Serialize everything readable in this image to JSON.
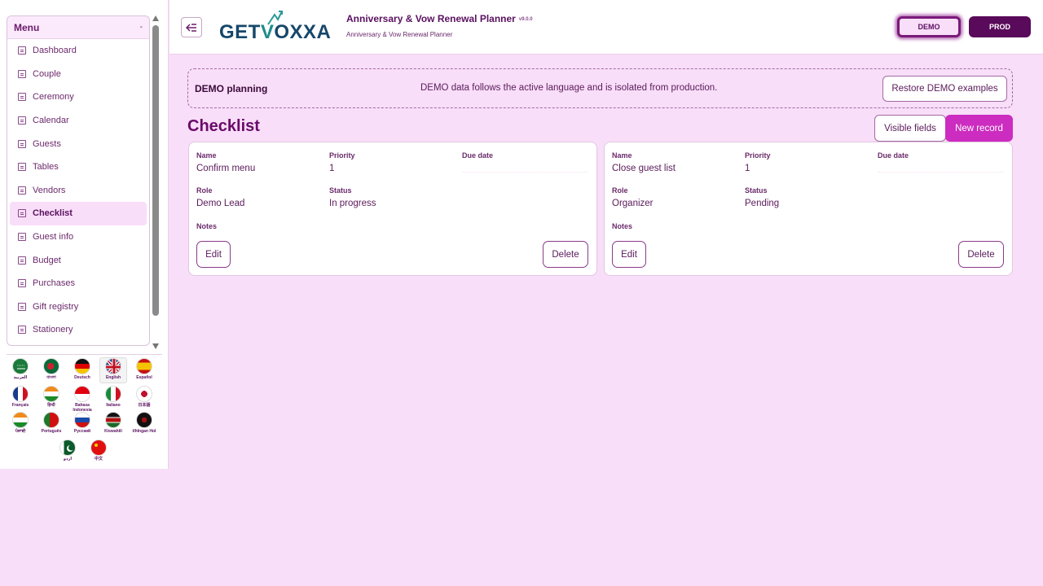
{
  "sidebar": {
    "menu_title": "Menu",
    "toggle": "-",
    "items": [
      {
        "label": "Dashboard"
      },
      {
        "label": "Couple"
      },
      {
        "label": "Ceremony"
      },
      {
        "label": "Calendar"
      },
      {
        "label": "Guests"
      },
      {
        "label": "Tables"
      },
      {
        "label": "Vendors"
      },
      {
        "label": "Checklist",
        "active": true
      },
      {
        "label": "Guest info"
      },
      {
        "label": "Budget"
      },
      {
        "label": "Purchases"
      },
      {
        "label": "Gift registry"
      },
      {
        "label": "Stationery"
      }
    ],
    "languages": [
      {
        "label": "العربية",
        "flag": "saudi-arabia"
      },
      {
        "label": "বাংলা",
        "flag": "bangladesh"
      },
      {
        "label": "Deutsch",
        "flag": "germany"
      },
      {
        "label": "English",
        "flag": "uk",
        "selected": true
      },
      {
        "label": "Español",
        "flag": "spain"
      },
      {
        "label": "Français",
        "flag": "france"
      },
      {
        "label": "हिन्दी",
        "flag": "india"
      },
      {
        "label": "Bahasa Indonesia",
        "flag": "indonesia"
      },
      {
        "label": "Italiano",
        "flag": "italy"
      },
      {
        "label": "日本語",
        "flag": "japan"
      },
      {
        "label": "ਪੰਜਾਬੀ",
        "flag": "india"
      },
      {
        "label": "Português",
        "flag": "portugal"
      },
      {
        "label": "Русский",
        "flag": "russia"
      },
      {
        "label": "Kiswahili",
        "flag": "kenya"
      },
      {
        "label": "tlhIngan Hol",
        "flag": "klingon"
      },
      {
        "label": "اردو",
        "flag": "pakistan"
      },
      {
        "label": "中文",
        "flag": "china"
      }
    ]
  },
  "header": {
    "logo_text_a": "GET",
    "logo_text_v": "V",
    "logo_text_b": "OXXA",
    "app_title": "Anniversary & Vow Renewal Planner",
    "version": "v9.0.0",
    "app_subtitle": "Anniversary & Vow Renewal Planner",
    "env_demo": "DEMO",
    "env_prod": "PROD"
  },
  "banner": {
    "title": "DEMO planning",
    "text": "DEMO data follows the active language and is isolated from production.",
    "restore_label": "Restore DEMO examples"
  },
  "page": {
    "title": "Checklist",
    "visible_fields_label": "Visible fields",
    "new_record_label": "New record"
  },
  "labels": {
    "name": "Name",
    "priority": "Priority",
    "due_date": "Due date",
    "role": "Role",
    "status": "Status",
    "notes": "Notes",
    "edit": "Edit",
    "delete": "Delete"
  },
  "records": [
    {
      "name": "Confirm menu",
      "priority": "1",
      "due_date": "",
      "role": "Demo Lead",
      "status": "In progress",
      "notes": ""
    },
    {
      "name": "Close guest list",
      "priority": "1",
      "due_date": "",
      "role": "Organizer",
      "status": "Pending",
      "notes": ""
    }
  ]
}
